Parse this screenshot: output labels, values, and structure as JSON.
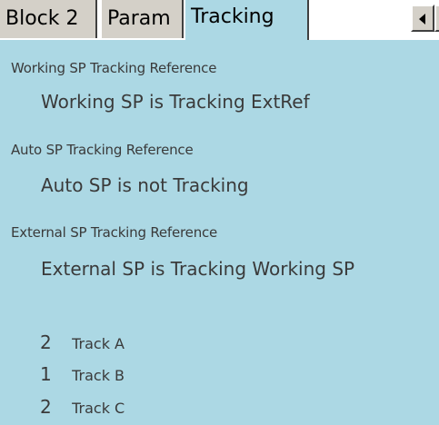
{
  "tabs": [
    {
      "label": "Block 2"
    },
    {
      "label": "Param"
    },
    {
      "label": "Tracking"
    }
  ],
  "sections": {
    "working": {
      "heading": "Working SP Tracking Reference",
      "status": "Working SP is Tracking ExtRef"
    },
    "auto": {
      "heading": "Auto SP Tracking Reference",
      "status": "Auto SP is not Tracking"
    },
    "external": {
      "heading": "External SP Tracking Reference",
      "status": "External SP is Tracking Working SP"
    }
  },
  "tracks": [
    {
      "value": "2",
      "label": "Track A"
    },
    {
      "value": "1",
      "label": "Track B"
    },
    {
      "value": "2",
      "label": "Track C"
    }
  ],
  "colors": {
    "panel_bg": "#acd8e4",
    "tab_bg": "#d4d0c8",
    "text": "#3a3a3a"
  },
  "icons": {
    "scroll_left": "triangle-left",
    "scroll_right": "triangle-right"
  }
}
